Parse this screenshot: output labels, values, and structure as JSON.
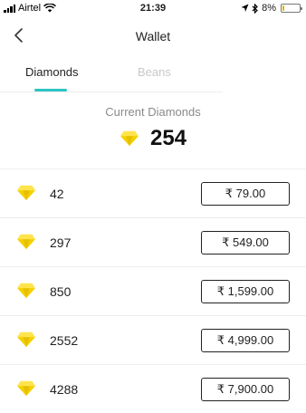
{
  "status_bar": {
    "carrier": "Airtel",
    "time": "21:39",
    "battery": "8%",
    "battery_level": 0.08
  },
  "nav": {
    "title": "Wallet",
    "back_icon": "chevron-left-icon"
  },
  "tabs": [
    {
      "label": "Diamonds",
      "active": true
    },
    {
      "label": "Beans",
      "active": false
    }
  ],
  "balance": {
    "label": "Current Diamonds",
    "value": "254"
  },
  "packages": [
    {
      "amount": "42",
      "price": "₹ 79.00"
    },
    {
      "amount": "297",
      "price": "₹ 549.00"
    },
    {
      "amount": "850",
      "price": "₹ 1,599.00"
    },
    {
      "amount": "2552",
      "price": "₹ 4,999.00"
    },
    {
      "amount": "4288",
      "price": "₹ 7,900.00"
    }
  ],
  "colors": {
    "accent": "#2ec4c4",
    "diamond": "#f5d000",
    "battery": "#e0b200"
  }
}
